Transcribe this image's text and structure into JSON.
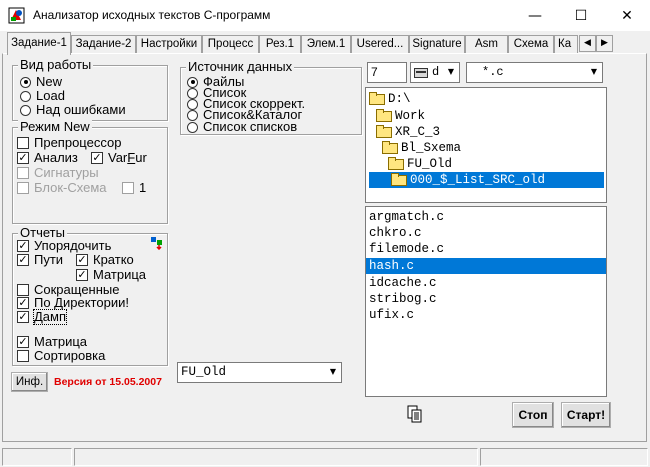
{
  "window": {
    "title": "Анализатор исходных текстов С-программ",
    "minimize_glyph": "—",
    "maximize_glyph": "☐",
    "close_glyph": "✕"
  },
  "tabs": [
    {
      "label": "Задание-1",
      "active": true
    },
    {
      "label": "Задание-2"
    },
    {
      "label": "Настройки"
    },
    {
      "label": "Процесс"
    },
    {
      "label": "Рез.1"
    },
    {
      "label": "Элем.1"
    },
    {
      "label": "Usered..."
    },
    {
      "label": "Signature"
    },
    {
      "label": "Asm"
    },
    {
      "label": "Схема"
    },
    {
      "label": "Ка"
    }
  ],
  "tab_scroll": {
    "left": "◀",
    "right": "▶"
  },
  "work_mode": {
    "title": "Вид работы",
    "options": [
      {
        "label": "New",
        "selected": true
      },
      {
        "label": "Load",
        "selected": false
      },
      {
        "label": "Над ошибками",
        "selected": false
      }
    ]
  },
  "mode_new": {
    "title": "Режим New",
    "preprocessor": {
      "label": "Препроцессор",
      "checked": false
    },
    "analysis": {
      "label": "Анализ",
      "checked": true
    },
    "varfur": {
      "label_pre": "Var",
      "label_u": "F",
      "label_post": "ur",
      "checked": true
    },
    "signatures": {
      "label": "Сигнатуры",
      "checked": false
    },
    "block_scheme": {
      "label": "Блок-Схема",
      "checked": false
    },
    "block_count": {
      "label": "1",
      "checked": false
    }
  },
  "data_source": {
    "title": "Источник данных",
    "options": [
      {
        "label": "Файлы",
        "selected": true
      },
      {
        "label": "Список",
        "selected": false
      },
      {
        "label": "Список скоррект.",
        "selected": false
      },
      {
        "label": "Список&Каталог",
        "selected": false
      },
      {
        "label": "Список списков",
        "selected": false
      }
    ]
  },
  "reports": {
    "title": "Отчеты",
    "order": {
      "label": "Упорядочить",
      "checked": true
    },
    "paths": {
      "label": "Пути",
      "checked": true
    },
    "brief": {
      "label": "Кратко",
      "checked": true
    },
    "matrix_sub": {
      "label": "Матрица",
      "checked": true
    },
    "abbrev": {
      "label": "Сокращенные",
      "checked": false
    },
    "by_dir": {
      "label": "По Директории!",
      "checked": true
    },
    "dump": {
      "label": "Дамп",
      "checked": true
    },
    "matrix": {
      "label": "Матрица",
      "checked": true
    },
    "sort": {
      "label": "Сортировка",
      "checked": false
    }
  },
  "info_button": "Инф.",
  "version": "Версия от 15.05.2007",
  "version_color": "#e00000",
  "folder_select": "FU_Old",
  "top_controls": {
    "number": "7",
    "drive": "d",
    "mask": "*.c"
  },
  "dir_tree": [
    {
      "label": "D:\\",
      "indent": 0
    },
    {
      "label": "Work",
      "indent": 1
    },
    {
      "label": "XR_C_3",
      "indent": 2
    },
    {
      "label": "Bl_Sxema",
      "indent": 3
    },
    {
      "label": "FU_Old",
      "indent": 4
    },
    {
      "label": "000_$_List_SRC_old",
      "indent": 5,
      "selected": true
    }
  ],
  "files": [
    {
      "label": "argmatch.c"
    },
    {
      "label": "chkro.c"
    },
    {
      "label": "filemode.c"
    },
    {
      "label": "hash.c",
      "selected": true
    },
    {
      "label": "idcache.c"
    },
    {
      "label": "stribog.c"
    },
    {
      "label": "ufix.c"
    }
  ],
  "buttons": {
    "stop": "Стоп",
    "start": "Старт!"
  },
  "accent_color": "#0078d7"
}
